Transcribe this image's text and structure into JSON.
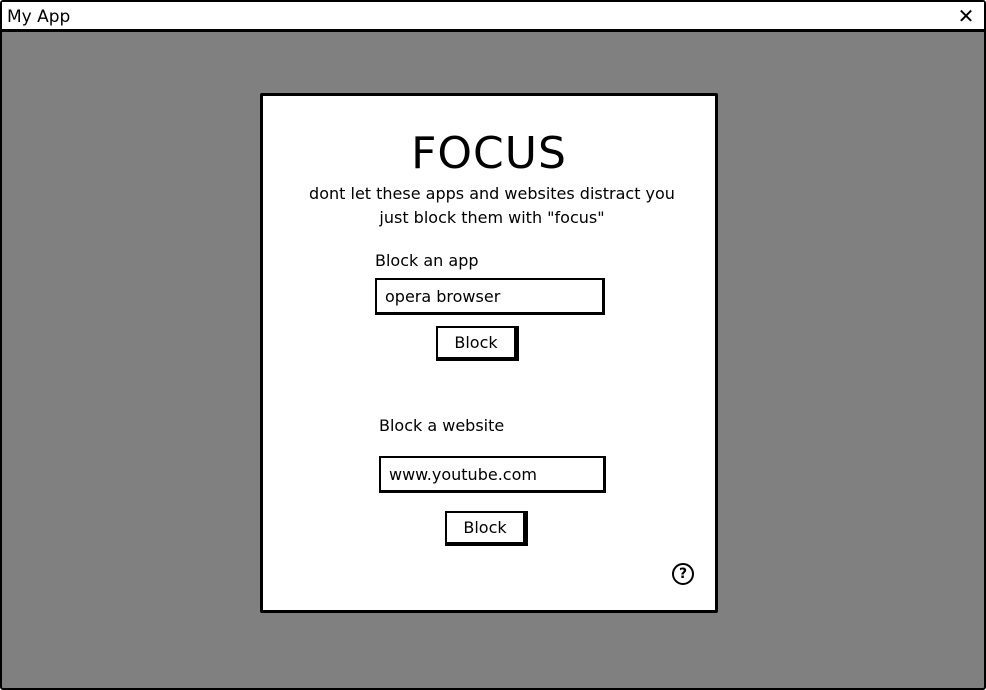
{
  "window": {
    "title": "My App",
    "close_glyph": "✕"
  },
  "panel": {
    "heading": "FOCUS",
    "subtitle_line1": "dont let these apps and websites distract you",
    "subtitle_line2": "just block them with \"focus\""
  },
  "block_app": {
    "label": "Block an app",
    "input_value": "opera browser",
    "button_label": "Block"
  },
  "block_website": {
    "label": "Block a website",
    "input_value": "www.youtube.com",
    "button_label": "Block"
  },
  "help": {
    "glyph": "?",
    "icon": "help-circle-icon"
  },
  "colors": {
    "background": "#808080",
    "panel": "#ffffff",
    "ink": "#000000"
  }
}
